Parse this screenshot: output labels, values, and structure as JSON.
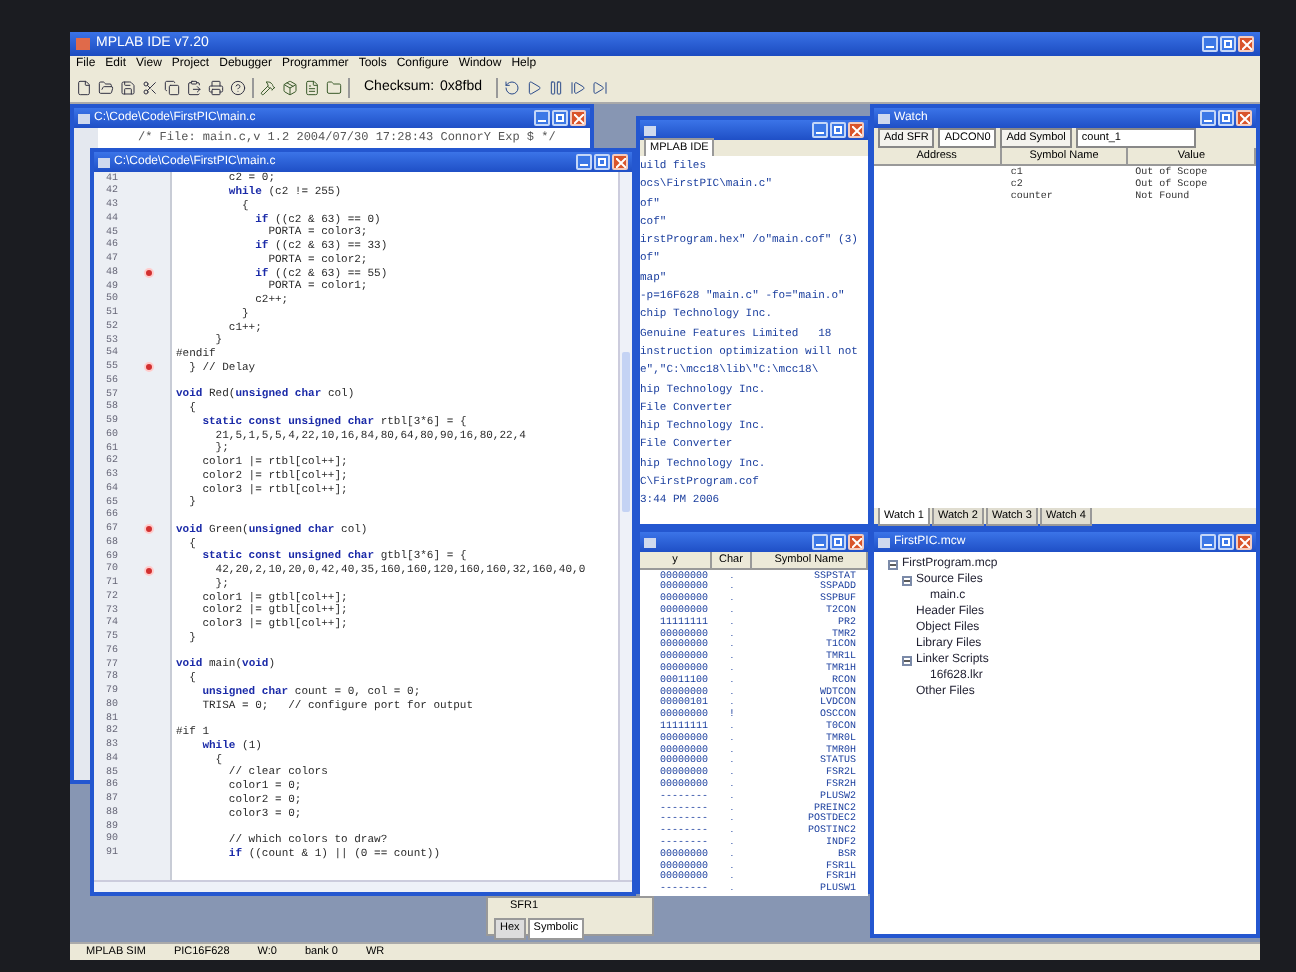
{
  "app": {
    "title": "MPLAB IDE v7.20",
    "menu": [
      "File",
      "Edit",
      "View",
      "Project",
      "Debugger",
      "Programmer",
      "Tools",
      "Configure",
      "Window",
      "Help"
    ],
    "checksum_label": "Checksum:",
    "checksum_value": "0x8fbd"
  },
  "editor_back": {
    "title": "C:\\Code\\Code\\FirstPIC\\main.c",
    "first_line": "/* File: main.c,v 1.2 2004/07/30 17:28:43 ConnorY Exp $ */"
  },
  "editor": {
    "title": "C:\\Code\\Code\\FirstPIC\\main.c",
    "lines": [
      {
        "number": "41",
        "code": "        c2 = 0;",
        "breakpoint": false
      },
      {
        "number": "42",
        "code": "        **while** (c2 != 255)",
        "breakpoint": false
      },
      {
        "number": "43",
        "code": "          {",
        "breakpoint": false
      },
      {
        "number": "44",
        "code": "            **if** ((c2 & 63) == 0)",
        "breakpoint": false
      },
      {
        "number": "45",
        "code": "              PORTA = color3;",
        "breakpoint": false
      },
      {
        "number": "46",
        "code": "            **if** ((c2 & 63) == 33)",
        "breakpoint": false
      },
      {
        "number": "47",
        "code": "              PORTA = color2;",
        "breakpoint": false
      },
      {
        "number": "48",
        "code": "            **if** ((c2 & 63) == 55)",
        "breakpoint": true
      },
      {
        "number": "49",
        "code": "              PORTA = color1;",
        "breakpoint": false
      },
      {
        "number": "50",
        "code": "            c2++;",
        "breakpoint": false
      },
      {
        "number": "51",
        "code": "          }",
        "breakpoint": false
      },
      {
        "number": "52",
        "code": "        c1++;",
        "breakpoint": false
      },
      {
        "number": "53",
        "code": "      }",
        "breakpoint": false
      },
      {
        "number": "54",
        "code": "#endif",
        "breakpoint": false
      },
      {
        "number": "55",
        "code": "  } // Delay",
        "breakpoint": true
      },
      {
        "number": "56",
        "breakpoint": false
      },
      {
        "number": "57",
        "code": "**void** Red(**unsigned char** col)",
        "breakpoint": false
      },
      {
        "number": "58",
        "code": "  {",
        "breakpoint": false
      },
      {
        "number": "59",
        "code": "    **static const unsigned char** rtbl[3*6] = {",
        "breakpoint": false
      },
      {
        "number": "60",
        "code": "      21,5,1,5,5,4,22,10,16,84,80,64,80,90,16,80,22,4",
        "breakpoint": false
      },
      {
        "number": "61",
        "code": "      };",
        "breakpoint": false
      },
      {
        "number": "62",
        "code": "    color1 |= rtbl[col++];",
        "breakpoint": false
      },
      {
        "number": "63",
        "code": "    color2 |= rtbl[col++];",
        "breakpoint": false
      },
      {
        "number": "64",
        "code": "    color3 |= rtbl[col++];",
        "breakpoint": false
      },
      {
        "number": "65",
        "code": "  }",
        "breakpoint": false
      },
      {
        "number": "66",
        "breakpoint": false
      },
      {
        "number": "67",
        "code": "**void** Green(**unsigned char** col)",
        "breakpoint": true
      },
      {
        "number": "68",
        "code": "  {",
        "breakpoint": false
      },
      {
        "number": "69",
        "code": "    **static const unsigned char** gtbl[3*6] = {",
        "breakpoint": false
      },
      {
        "number": "70",
        "code": "      42,20,2,10,20,0,42,40,35,160,160,120,160,160,32,160,40,0",
        "breakpoint": true
      },
      {
        "number": "71",
        "code": "      };",
        "breakpoint": false
      },
      {
        "number": "72",
        "code": "    color1 |= gtbl[col++];",
        "breakpoint": false
      },
      {
        "number": "73",
        "code": "    color2 |= gtbl[col++];",
        "breakpoint": false
      },
      {
        "number": "74",
        "code": "    color3 |= gtbl[col++];",
        "breakpoint": false
      },
      {
        "number": "75",
        "code": "  }",
        "breakpoint": false
      },
      {
        "number": "76",
        "breakpoint": false
      },
      {
        "number": "77",
        "code": "**void** main(**void**)",
        "breakpoint": false
      },
      {
        "number": "78",
        "code": "  {",
        "breakpoint": false
      },
      {
        "number": "79",
        "code": "    **unsigned char** count = 0, col = 0;",
        "breakpoint": false
      },
      {
        "number": "80",
        "code": "    TRISA = 0;   // configure port for output",
        "breakpoint": false
      },
      {
        "number": "81",
        "breakpoint": false
      },
      {
        "number": "82",
        "code": "#if 1",
        "breakpoint": false
      },
      {
        "number": "83",
        "code": "    **while** (1)",
        "breakpoint": false
      },
      {
        "number": "84",
        "code": "      {",
        "breakpoint": false
      },
      {
        "number": "85",
        "code": "        // clear colors",
        "breakpoint": false
      },
      {
        "number": "86",
        "code": "        color1 = 0;",
        "breakpoint": false
      },
      {
        "number": "87",
        "code": "        color2 = 0;",
        "breakpoint": false
      },
      {
        "number": "88",
        "code": "        color3 = 0;",
        "breakpoint": false
      },
      {
        "number": "89",
        "breakpoint": false
      },
      {
        "number": "90",
        "code": "        // which colors to draw?",
        "breakpoint": false
      },
      {
        "number": "91",
        "code": "        **if** ((count & 1) || (0 == count))",
        "breakpoint": false
      }
    ]
  },
  "output": {
    "tab": "MPLAB IDE",
    "lines": [
      "uild files",
      "ocs\\FirstPIC\\main.c\"",
      "of\"",
      "cof\"",
      "irstProgram.hex\" /o\"main.cof\" (3)",
      "of\"",
      "map\"",
      "-p=16F628 \"main.c\" -fo=\"main.o\"",
      "chip Technology Inc.",
      "Genuine Features Limited   18",
      "instruction optimization will not",
      "e\",\"C:\\mcc18\\lib\\\"C:\\mcc18\\",
      "hip Technology Inc.",
      "File Converter",
      "hip Technology Inc.",
      "File Converter",
      "hip Technology Inc.",
      "C\\FirstProgram.cof",
      "3:44 PM 2006"
    ]
  },
  "file_registers": {
    "columns": [
      "y",
      "Char",
      "Symbol Name"
    ],
    "rows": [
      {
        "value": "00000000",
        "char": ".",
        "symbol": "SSPSTAT"
      },
      {
        "value": "00000000",
        "char": ".",
        "symbol": "SSPADD"
      },
      {
        "value": "00000000",
        "char": ".",
        "symbol": "SSPBUF"
      },
      {
        "value": "00000000",
        "char": ".",
        "symbol": "T2CON"
      },
      {
        "value": "11111111",
        "char": ".",
        "symbol": "PR2"
      },
      {
        "value": "00000000",
        "char": ".",
        "symbol": "TMR2"
      },
      {
        "value": "00000000",
        "char": ".",
        "symbol": "T1CON"
      },
      {
        "value": "00000000",
        "char": ".",
        "symbol": "TMR1L"
      },
      {
        "value": "00000000",
        "char": ".",
        "symbol": "TMR1H"
      },
      {
        "value": "00011100",
        "char": ".",
        "symbol": "RCON"
      },
      {
        "value": "00000000",
        "char": ".",
        "symbol": "WDTCON"
      },
      {
        "value": "00000101",
        "char": ".",
        "symbol": "LVDCON"
      },
      {
        "value": "00000000",
        "char": "!",
        "symbol": "OSCCON"
      },
      {
        "value": "11111111",
        "char": ".",
        "symbol": "T0CON"
      },
      {
        "value": "00000000",
        "char": ".",
        "symbol": "TMR0L"
      },
      {
        "value": "00000000",
        "char": ".",
        "symbol": "TMR0H"
      },
      {
        "value": "00000000",
        "char": ".",
        "symbol": "STATUS"
      },
      {
        "value": "00000000",
        "char": ".",
        "symbol": "FSR2L"
      },
      {
        "value": "00000000",
        "char": ".",
        "symbol": "FSR2H"
      },
      {
        "value": "--------",
        "char": ".",
        "symbol": "PLUSW2"
      },
      {
        "value": "--------",
        "char": ".",
        "symbol": "PREINC2"
      },
      {
        "value": "--------",
        "char": ".",
        "symbol": "POSTDEC2"
      },
      {
        "value": "--------",
        "char": ".",
        "symbol": "POSTINC2"
      },
      {
        "value": "--------",
        "char": ".",
        "symbol": "INDF2"
      },
      {
        "value": "00000000",
        "char": ".",
        "symbol": "BSR"
      },
      {
        "value": "00000000",
        "char": ".",
        "symbol": "FSR1L"
      },
      {
        "value": "00000000",
        "char": ".",
        "symbol": "FSR1H"
      },
      {
        "value": "--------",
        "char": ".",
        "symbol": "PLUSW1"
      }
    ]
  },
  "sfr_panel": {
    "label": "SFR1",
    "tabs": [
      {
        "label": "Hex",
        "selected": false
      },
      {
        "label": "Symbolic",
        "selected": true
      }
    ]
  },
  "watch": {
    "title": "Watch",
    "add_sfr": "Add SFR",
    "sfr": "ADCON0",
    "add_symbol": "Add Symbol",
    "symbol": "count_1",
    "columns": [
      "Address",
      "Symbol Name",
      "Value"
    ],
    "rows": [
      {
        "symbol": "c1",
        "value": "Out of Scope"
      },
      {
        "symbol": "c2",
        "value": "Out of Scope"
      },
      {
        "symbol": "counter",
        "value": "Not Found"
      }
    ],
    "tabs": [
      {
        "label": "Watch 1",
        "selected": true
      },
      {
        "label": "Watch 2",
        "selected": false
      },
      {
        "label": "Watch 3",
        "selected": false
      },
      {
        "label": "Watch 4",
        "selected": false
      }
    ]
  },
  "project": {
    "title": "FirstPIC.mcw",
    "tree": [
      {
        "label": "FirstProgram.mcp",
        "expanded": true,
        "children": [
          {
            "label": "Source Files",
            "expanded": true,
            "children": [
              {
                "label": "main.c"
              }
            ]
          },
          {
            "label": "Header Files"
          },
          {
            "label": "Object Files"
          },
          {
            "label": "Library Files"
          },
          {
            "label": "Linker Scripts",
            "expanded": true,
            "children": [
              {
                "label": "16f628.lkr"
              }
            ]
          },
          {
            "label": "Other Files"
          }
        ]
      }
    ]
  },
  "status_bar": [
    "MPLAB SIM",
    "PIC16F628",
    "W:0",
    "bank 0",
    "WR"
  ]
}
